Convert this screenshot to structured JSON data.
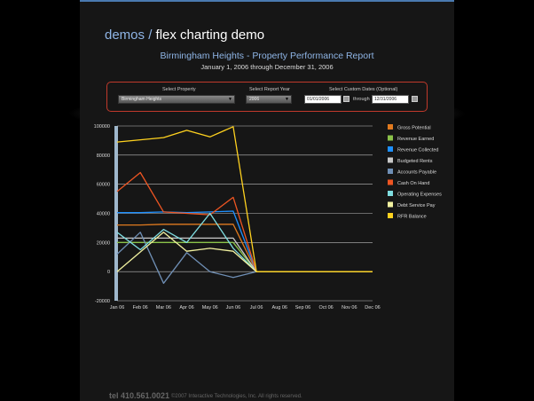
{
  "brand": {
    "prefix": "demos /",
    "name": "flex charting demo"
  },
  "report": {
    "title": "Birmingham Heights - Property Performance Report",
    "range": "January 1, 2006 through December 31, 2006"
  },
  "controls": {
    "property_label": "Select Property",
    "property_value": "Birmingham Heights",
    "year_label": "Select Report Year",
    "year_value": "2006",
    "dates_label": "Select Custom Dates (Optional)",
    "start_date": "01/01/2006",
    "through_label": "through",
    "end_date": "12/31/2006"
  },
  "footer": {
    "tel": "tel 410.561.0021",
    "copyright": "©2007 Interactive Technologies, Inc. All rights reserved."
  },
  "chart_data": {
    "type": "line",
    "categories": [
      "Jan 06",
      "Feb 06",
      "Mar 06",
      "Apr 06",
      "May 06",
      "Jun 06",
      "Jul 06",
      "Aug 06",
      "Sep 06",
      "Oct 06",
      "Nov 06",
      "Dec 06"
    ],
    "ylim": [
      -20000,
      100000
    ],
    "yticks": [
      100000,
      80000,
      60000,
      40000,
      20000,
      0,
      -20000
    ],
    "grid": true,
    "legend": "right",
    "series": [
      {
        "name": "Gross Potential",
        "color": "#e07a1f",
        "values": [
          32000,
          32000,
          32500,
          32500,
          32500,
          32500,
          0,
          0,
          0,
          0,
          0,
          0
        ]
      },
      {
        "name": "Revenue Earned",
        "color": "#8bc34a",
        "values": [
          20000,
          20000,
          20000,
          20000,
          20000,
          20000,
          0,
          0,
          0,
          0,
          0,
          0
        ]
      },
      {
        "name": "Revenue Collected",
        "color": "#1e90ff",
        "values": [
          40500,
          40500,
          41000,
          40500,
          41000,
          41500,
          0,
          0,
          0,
          0,
          0,
          0
        ]
      },
      {
        "name": "Budgeted Rents",
        "color": "#c8c8c8",
        "values": [
          23000,
          23000,
          23000,
          23000,
          23000,
          23000,
          0,
          0,
          0,
          0,
          0,
          0
        ]
      },
      {
        "name": "Accounts Payable",
        "color": "#6f8fb5",
        "values": [
          12000,
          27000,
          -8000,
          13000,
          0,
          -4000,
          0,
          0,
          0,
          0,
          0,
          0
        ]
      },
      {
        "name": "Cash On Hand",
        "color": "#ee5522",
        "values": [
          55000,
          68000,
          41000,
          40000,
          39000,
          51000,
          0,
          0,
          0,
          0,
          0,
          0
        ]
      },
      {
        "name": "Operating Expenses",
        "color": "#7fdde0",
        "values": [
          27000,
          15000,
          29000,
          20000,
          40000,
          16000,
          0,
          0,
          0,
          0,
          0,
          0
        ]
      },
      {
        "name": "Debt Service Pay",
        "color": "#f2f2a0",
        "values": [
          0,
          13500,
          27000,
          14000,
          16000,
          14000,
          0,
          0,
          0,
          0,
          0,
          0
        ]
      },
      {
        "name": "RFR Balance",
        "color": "#ffd21f",
        "values": [
          89000,
          90500,
          92000,
          97000,
          92500,
          99500,
          0,
          0,
          0,
          0,
          0,
          0
        ]
      }
    ]
  }
}
